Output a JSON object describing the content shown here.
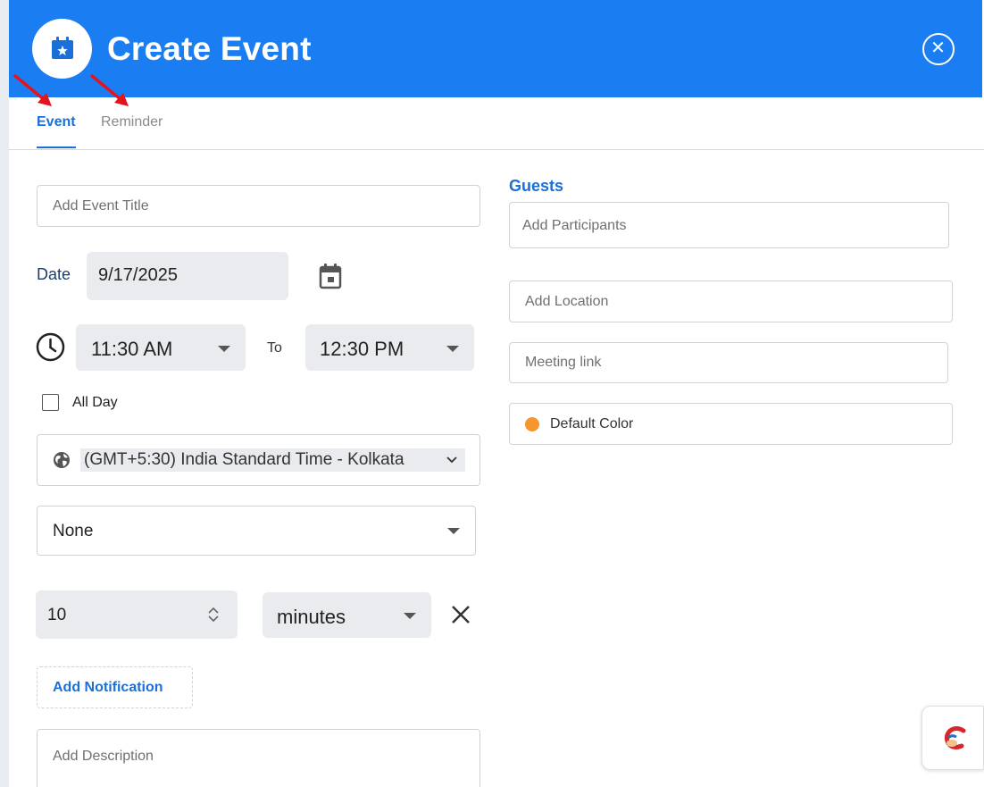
{
  "header": {
    "title": "Create Event",
    "icon": "calendar-star-icon",
    "close_icon": "close-circle-icon"
  },
  "tabs": [
    {
      "label": "Event",
      "active": true
    },
    {
      "label": "Reminder",
      "active": false
    }
  ],
  "form": {
    "title_placeholder": "Add Event Title",
    "date_label": "Date",
    "date_value": "9/17/2025",
    "start_time": "11:30 AM",
    "to_label": "To",
    "end_time": "12:30 PM",
    "all_day_label": "All Day",
    "all_day_checked": false,
    "timezone": "(GMT+5:30) India Standard Time - Kolkata",
    "repeat": "None",
    "notification_value": "10",
    "notification_unit": "minutes",
    "add_notification_label": "Add Notification",
    "description_placeholder": "Add Description"
  },
  "right": {
    "guests_label": "Guests",
    "participants_placeholder": "Add Participants",
    "location_placeholder": "Add Location",
    "meeting_link_placeholder": "Meeting link",
    "color_label": "Default Color",
    "color_value": "#f7952f"
  },
  "colors": {
    "header": "#1a7ef2",
    "accent": "#1a6fd8",
    "arrow": "#e3141b"
  }
}
